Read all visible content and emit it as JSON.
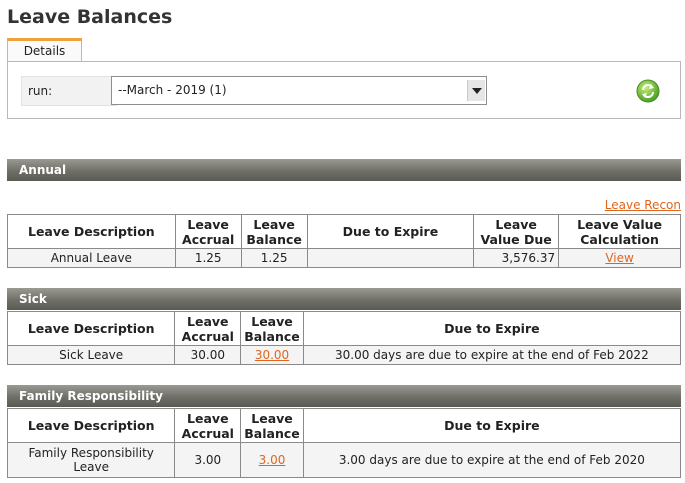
{
  "page": {
    "title": "Leave Balances"
  },
  "tabs": {
    "details": "Details"
  },
  "run": {
    "label": "run:",
    "selected": "--March - 2019 (1)"
  },
  "annual": {
    "title": "Annual",
    "recon_link": "Leave Recon",
    "headers": {
      "description": "Leave Description",
      "accrual": "Leave Accrual",
      "balance": "Leave Balance",
      "due": "Due to Expire",
      "value_due": "Leave Value Due",
      "calc": "Leave Value Calculation"
    },
    "row": {
      "description": "Annual Leave",
      "accrual": "1.25",
      "balance": "1.25",
      "due": "",
      "value_due": "3,576.37",
      "calc": "View"
    }
  },
  "sick": {
    "title": "Sick",
    "headers": {
      "description": "Leave Description",
      "accrual": "Leave Accrual",
      "balance": "Leave Balance",
      "due": "Due to Expire"
    },
    "row": {
      "description": "Sick Leave",
      "accrual": "30.00",
      "balance": "30.00",
      "due": "30.00 days are due to expire at the end of Feb 2022"
    }
  },
  "family": {
    "title": "Family Responsibility",
    "headers": {
      "description": "Leave Description",
      "accrual": "Leave Accrual",
      "balance": "Leave Balance",
      "due": "Due to Expire"
    },
    "row": {
      "description": "Family Responsibility Leave",
      "accrual": "3.00",
      "balance": "3.00",
      "due": "3.00 days are due to expire at the end of Feb 2020"
    }
  },
  "colors": {
    "link": "#e0651d",
    "tab_accent": "#f0a03c",
    "section_bar": "#6f6f68"
  }
}
